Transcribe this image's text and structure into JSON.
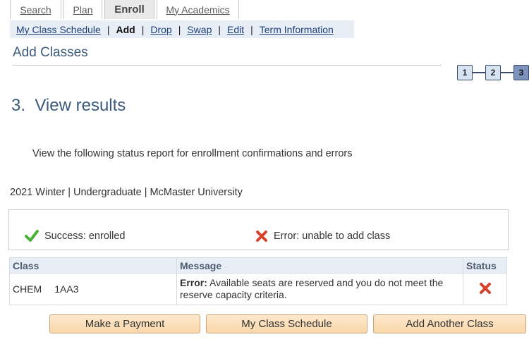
{
  "tabs": [
    {
      "label": "Search",
      "active": false
    },
    {
      "label": "Plan",
      "active": false
    },
    {
      "label": "Enroll",
      "active": true
    },
    {
      "label": "My Academics",
      "active": false
    }
  ],
  "subnav": {
    "my_class_schedule": "My Class Schedule",
    "add": "Add",
    "drop": "Drop",
    "swap": "Swap",
    "edit": "Edit",
    "term_information": "Term Information",
    "separator": "|"
  },
  "page_title": "Add Classes",
  "steps": [
    "1",
    "2",
    "3"
  ],
  "step_title": "3.  View results",
  "instructions": "View the following status report for enrollment confirmations and errors",
  "term_line": "2021 Winter | Undergraduate | McMaster University",
  "legend": {
    "success": "Success: enrolled",
    "error": "Error: unable to add class"
  },
  "table": {
    "headers": {
      "class": "Class",
      "message": "Message",
      "status": "Status"
    },
    "rows": [
      {
        "subject": "CHEM",
        "catalog": "1AA3",
        "message_label": "Error:",
        "message_text": " Available seats are reserved and you do not meet the reserve capacity criteria.",
        "status_icon": "error-x-icon"
      }
    ]
  },
  "buttons": {
    "make_payment": "Make a Payment",
    "my_class_schedule": "My Class Schedule",
    "add_another_class": "Add Another Class"
  },
  "colors": {
    "heading": "#3b5a7c",
    "link": "#1e3f75",
    "success_green": "#4caf3a",
    "error_red": "#d9412b",
    "button_fill": "#fbdfb9"
  }
}
